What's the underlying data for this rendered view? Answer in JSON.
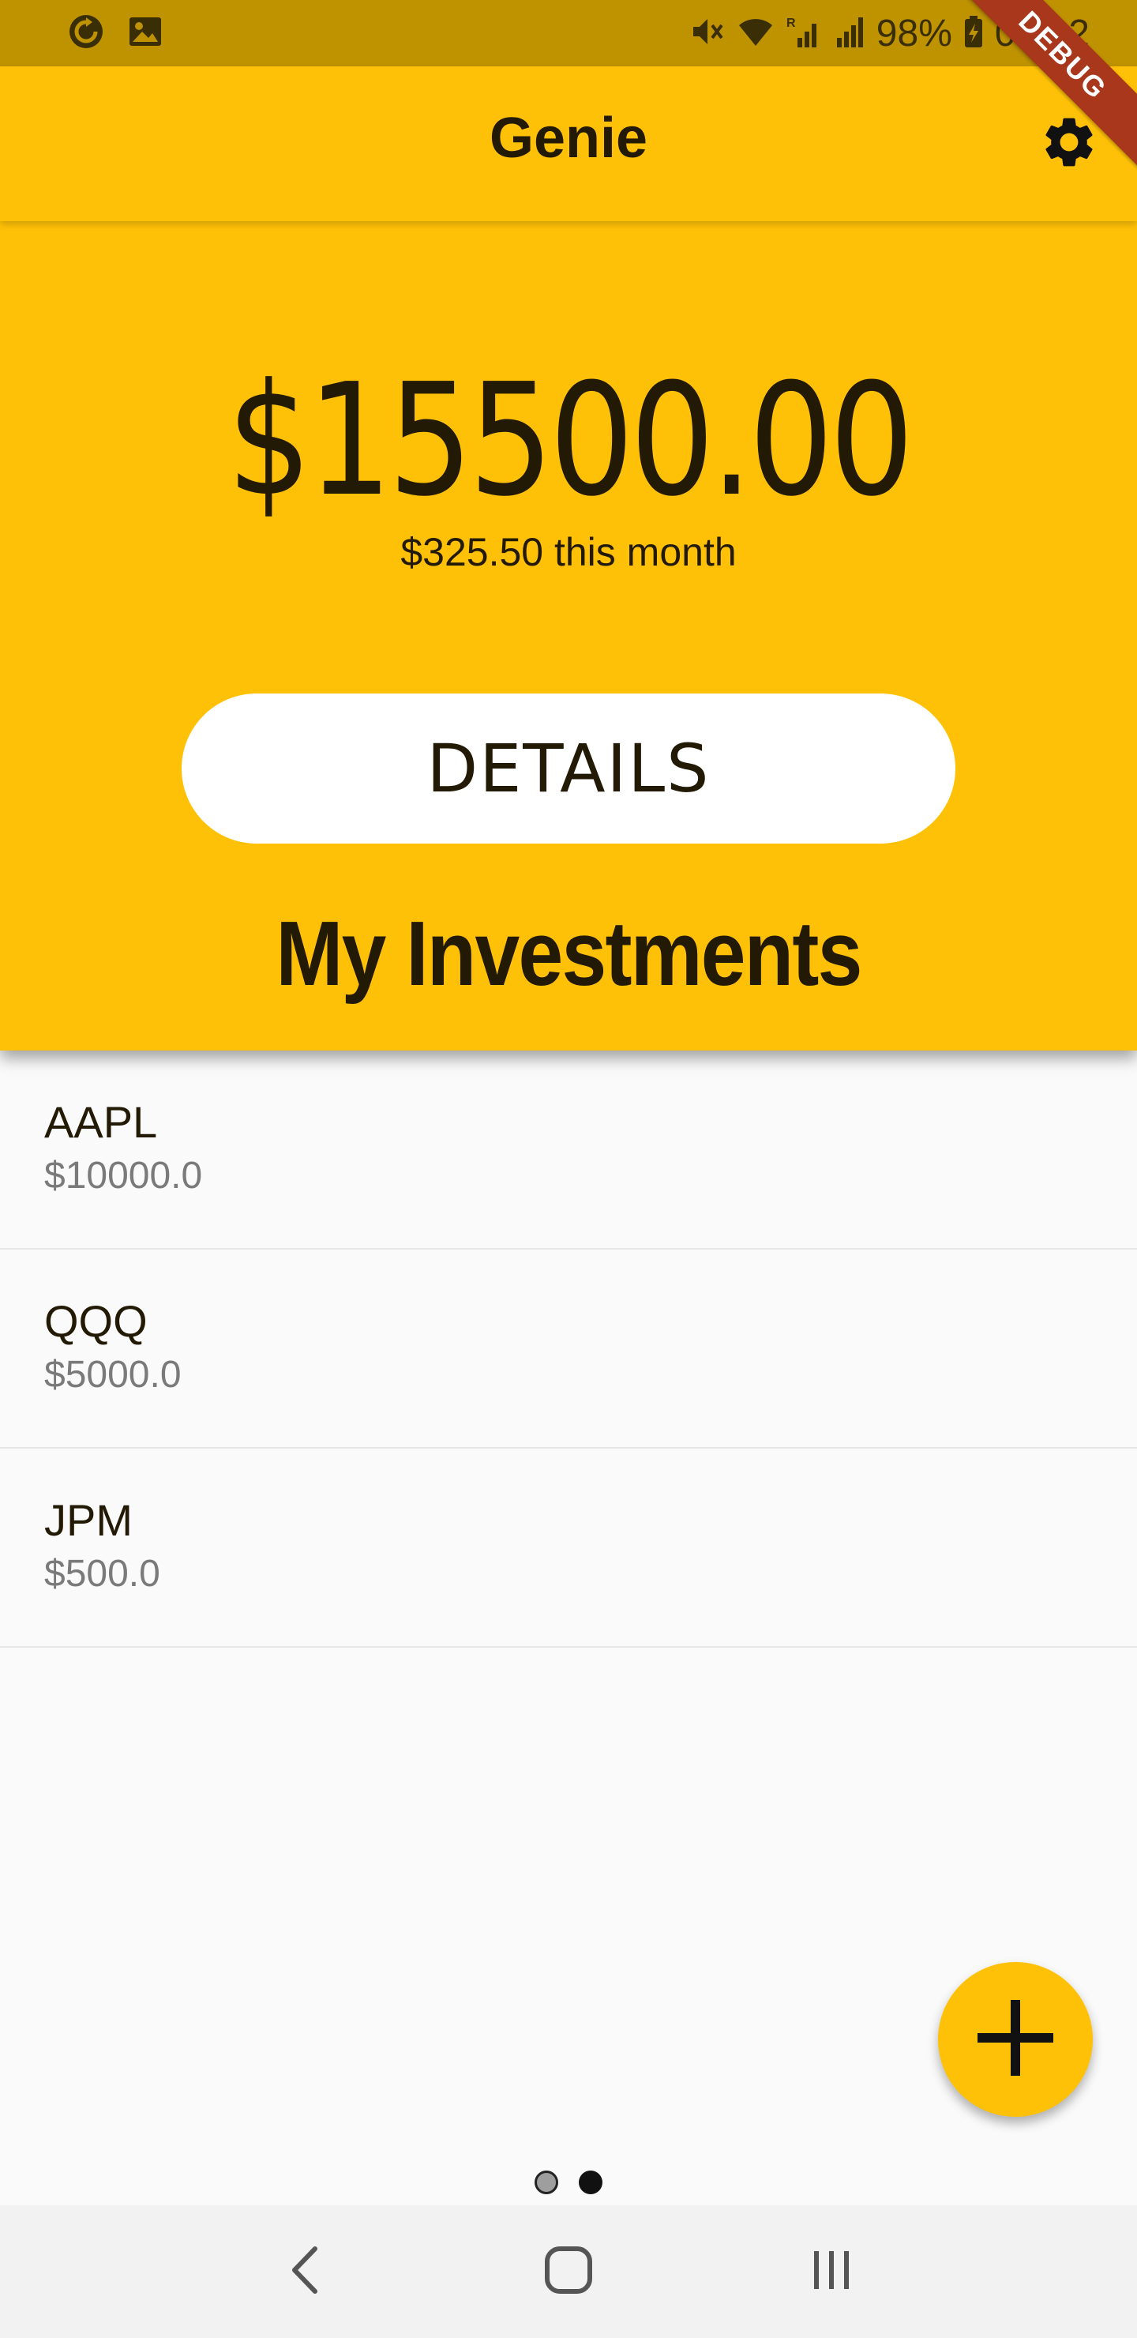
{
  "status_bar": {
    "battery": "98%",
    "time": "08:22",
    "icons": [
      "sync-icon",
      "image-icon",
      "mute-icon",
      "wifi-icon",
      "signal-r-icon",
      "signal-icon",
      "battery-charging-icon"
    ]
  },
  "debug_ribbon": "DEBUG",
  "app_bar": {
    "title": "Genie",
    "settings_icon": "gear-icon"
  },
  "summary": {
    "balance": "$15500.00",
    "monthly": "$325.50 this month",
    "details_label": "DETAILS"
  },
  "section_title": "My Investments",
  "investments": [
    {
      "symbol": "AAPL",
      "value": "$10000.0"
    },
    {
      "symbol": "QQQ",
      "value": "$5000.0"
    },
    {
      "symbol": "JPM",
      "value": "$500.0"
    }
  ],
  "fab": {
    "icon": "plus-icon"
  },
  "page_indicator": {
    "count": 2,
    "active_index": 1
  },
  "nav_bar": {
    "icons": [
      "back-icon",
      "home-icon",
      "recents-icon"
    ]
  },
  "colors": {
    "primary": "#ffc107",
    "status_bar": "#bf9200",
    "text": "#221a05",
    "debug": "#a8371b"
  }
}
